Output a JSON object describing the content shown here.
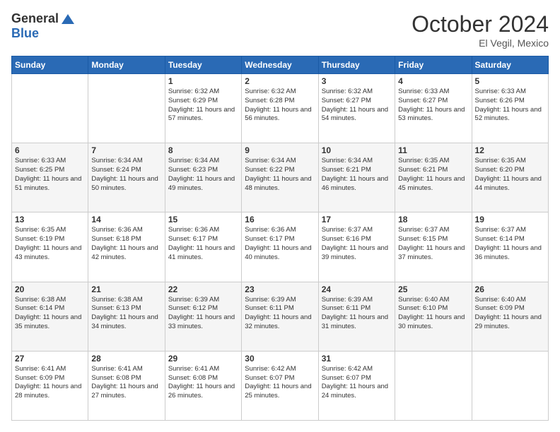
{
  "header": {
    "logo_line1": "General",
    "logo_line2": "Blue",
    "month_title": "October 2024",
    "location": "El Vegil, Mexico"
  },
  "weekdays": [
    "Sunday",
    "Monday",
    "Tuesday",
    "Wednesday",
    "Thursday",
    "Friday",
    "Saturday"
  ],
  "weeks": [
    [
      {
        "day": "",
        "content": ""
      },
      {
        "day": "",
        "content": ""
      },
      {
        "day": "1",
        "content": "Sunrise: 6:32 AM\nSunset: 6:29 PM\nDaylight: 11 hours and 57 minutes."
      },
      {
        "day": "2",
        "content": "Sunrise: 6:32 AM\nSunset: 6:28 PM\nDaylight: 11 hours and 56 minutes."
      },
      {
        "day": "3",
        "content": "Sunrise: 6:32 AM\nSunset: 6:27 PM\nDaylight: 11 hours and 54 minutes."
      },
      {
        "day": "4",
        "content": "Sunrise: 6:33 AM\nSunset: 6:27 PM\nDaylight: 11 hours and 53 minutes."
      },
      {
        "day": "5",
        "content": "Sunrise: 6:33 AM\nSunset: 6:26 PM\nDaylight: 11 hours and 52 minutes."
      }
    ],
    [
      {
        "day": "6",
        "content": "Sunrise: 6:33 AM\nSunset: 6:25 PM\nDaylight: 11 hours and 51 minutes."
      },
      {
        "day": "7",
        "content": "Sunrise: 6:34 AM\nSunset: 6:24 PM\nDaylight: 11 hours and 50 minutes."
      },
      {
        "day": "8",
        "content": "Sunrise: 6:34 AM\nSunset: 6:23 PM\nDaylight: 11 hours and 49 minutes."
      },
      {
        "day": "9",
        "content": "Sunrise: 6:34 AM\nSunset: 6:22 PM\nDaylight: 11 hours and 48 minutes."
      },
      {
        "day": "10",
        "content": "Sunrise: 6:34 AM\nSunset: 6:21 PM\nDaylight: 11 hours and 46 minutes."
      },
      {
        "day": "11",
        "content": "Sunrise: 6:35 AM\nSunset: 6:21 PM\nDaylight: 11 hours and 45 minutes."
      },
      {
        "day": "12",
        "content": "Sunrise: 6:35 AM\nSunset: 6:20 PM\nDaylight: 11 hours and 44 minutes."
      }
    ],
    [
      {
        "day": "13",
        "content": "Sunrise: 6:35 AM\nSunset: 6:19 PM\nDaylight: 11 hours and 43 minutes."
      },
      {
        "day": "14",
        "content": "Sunrise: 6:36 AM\nSunset: 6:18 PM\nDaylight: 11 hours and 42 minutes."
      },
      {
        "day": "15",
        "content": "Sunrise: 6:36 AM\nSunset: 6:17 PM\nDaylight: 11 hours and 41 minutes."
      },
      {
        "day": "16",
        "content": "Sunrise: 6:36 AM\nSunset: 6:17 PM\nDaylight: 11 hours and 40 minutes."
      },
      {
        "day": "17",
        "content": "Sunrise: 6:37 AM\nSunset: 6:16 PM\nDaylight: 11 hours and 39 minutes."
      },
      {
        "day": "18",
        "content": "Sunrise: 6:37 AM\nSunset: 6:15 PM\nDaylight: 11 hours and 37 minutes."
      },
      {
        "day": "19",
        "content": "Sunrise: 6:37 AM\nSunset: 6:14 PM\nDaylight: 11 hours and 36 minutes."
      }
    ],
    [
      {
        "day": "20",
        "content": "Sunrise: 6:38 AM\nSunset: 6:14 PM\nDaylight: 11 hours and 35 minutes."
      },
      {
        "day": "21",
        "content": "Sunrise: 6:38 AM\nSunset: 6:13 PM\nDaylight: 11 hours and 34 minutes."
      },
      {
        "day": "22",
        "content": "Sunrise: 6:39 AM\nSunset: 6:12 PM\nDaylight: 11 hours and 33 minutes."
      },
      {
        "day": "23",
        "content": "Sunrise: 6:39 AM\nSunset: 6:11 PM\nDaylight: 11 hours and 32 minutes."
      },
      {
        "day": "24",
        "content": "Sunrise: 6:39 AM\nSunset: 6:11 PM\nDaylight: 11 hours and 31 minutes."
      },
      {
        "day": "25",
        "content": "Sunrise: 6:40 AM\nSunset: 6:10 PM\nDaylight: 11 hours and 30 minutes."
      },
      {
        "day": "26",
        "content": "Sunrise: 6:40 AM\nSunset: 6:09 PM\nDaylight: 11 hours and 29 minutes."
      }
    ],
    [
      {
        "day": "27",
        "content": "Sunrise: 6:41 AM\nSunset: 6:09 PM\nDaylight: 11 hours and 28 minutes."
      },
      {
        "day": "28",
        "content": "Sunrise: 6:41 AM\nSunset: 6:08 PM\nDaylight: 11 hours and 27 minutes."
      },
      {
        "day": "29",
        "content": "Sunrise: 6:41 AM\nSunset: 6:08 PM\nDaylight: 11 hours and 26 minutes."
      },
      {
        "day": "30",
        "content": "Sunrise: 6:42 AM\nSunset: 6:07 PM\nDaylight: 11 hours and 25 minutes."
      },
      {
        "day": "31",
        "content": "Sunrise: 6:42 AM\nSunset: 6:07 PM\nDaylight: 11 hours and 24 minutes."
      },
      {
        "day": "",
        "content": ""
      },
      {
        "day": "",
        "content": ""
      }
    ]
  ]
}
